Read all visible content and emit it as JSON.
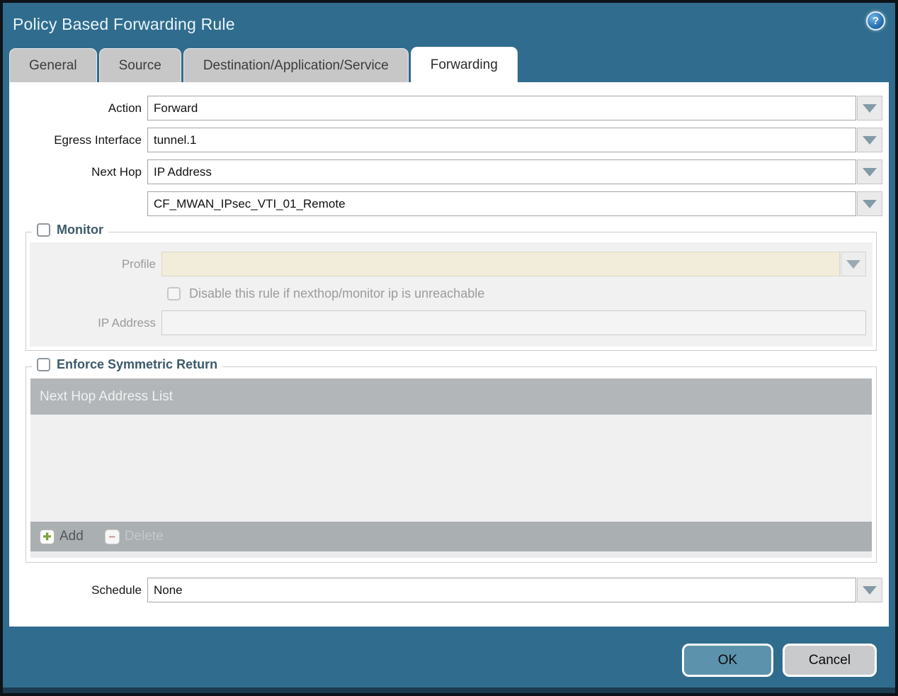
{
  "window": {
    "title": "Policy Based Forwarding Rule"
  },
  "icons": {
    "help_glyph": "?",
    "add_plus_glyph": "✚",
    "delete_minus_glyph": "−"
  },
  "tabs": [
    {
      "label": "General",
      "active": false
    },
    {
      "label": "Source",
      "active": false
    },
    {
      "label": "Destination/Application/Service",
      "active": false
    },
    {
      "label": "Forwarding",
      "active": true
    }
  ],
  "form": {
    "action": {
      "label": "Action",
      "value": "Forward"
    },
    "egress_interface": {
      "label": "Egress Interface",
      "value": "tunnel.1"
    },
    "next_hop": {
      "label": "Next Hop",
      "value": "IP Address"
    },
    "next_hop_address": {
      "value": "CF_MWAN_IPsec_VTI_01_Remote"
    },
    "schedule": {
      "label": "Schedule",
      "value": "None"
    }
  },
  "monitor": {
    "legend": "Monitor",
    "checked": false,
    "profile": {
      "label": "Profile",
      "value": ""
    },
    "disable_rule": {
      "label": "Disable this rule if nexthop/monitor ip is unreachable",
      "checked": false
    },
    "ip_address": {
      "label": "IP Address",
      "value": ""
    }
  },
  "symmetric_return": {
    "legend": "Enforce Symmetric Return",
    "checked": false,
    "table": {
      "header": "Next Hop Address List",
      "rows": []
    },
    "add_label": "Add",
    "delete_label": "Delete",
    "delete_enabled": false
  },
  "footer": {
    "ok_label": "OK",
    "cancel_label": "Cancel"
  },
  "colors": {
    "titlebar": "#306c8d",
    "active_tab": "#ffffff",
    "inactive_tab": "#c7c7c7",
    "ok_button": "#5d92ac",
    "cancel_button": "#c9cacc",
    "table_header": "#b2b6b9",
    "disabled_panel": "#f1f1f2",
    "profile_field": "#f2ecda",
    "add_plus": "#7ca23b",
    "delete_minus": "#c2948b",
    "legend_text": "#3d5a69"
  }
}
